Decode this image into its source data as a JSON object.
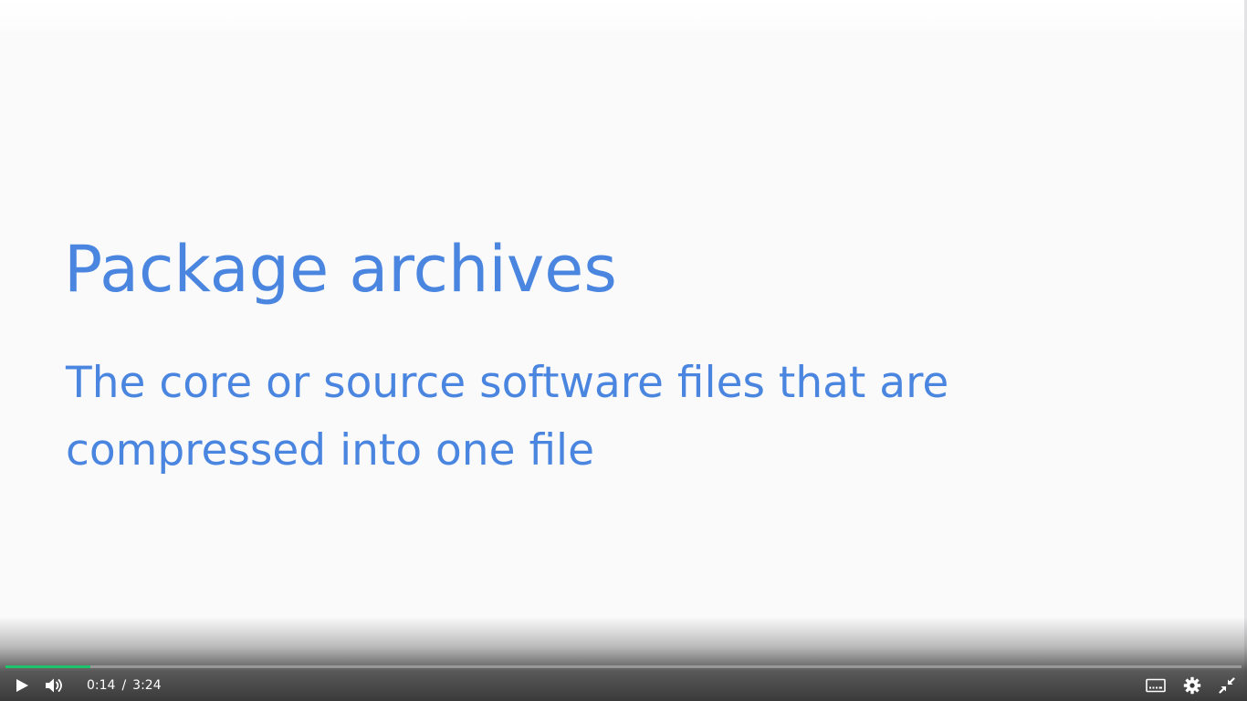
{
  "slide": {
    "title": "Package archives",
    "body": "The core or source software files that are compressed into one file",
    "text_color": "#4a86e0",
    "background": "#fbfafb"
  },
  "player": {
    "current_time": "0:14",
    "separator": "/",
    "duration": "3:24",
    "progress_fraction": 0.069,
    "progress_color": "#1ec46b",
    "icons": {
      "play": "play-icon",
      "volume": "volume-icon",
      "captions": "captions-icon",
      "settings": "gear-icon",
      "exit_fullscreen": "exit-fullscreen-icon"
    }
  }
}
